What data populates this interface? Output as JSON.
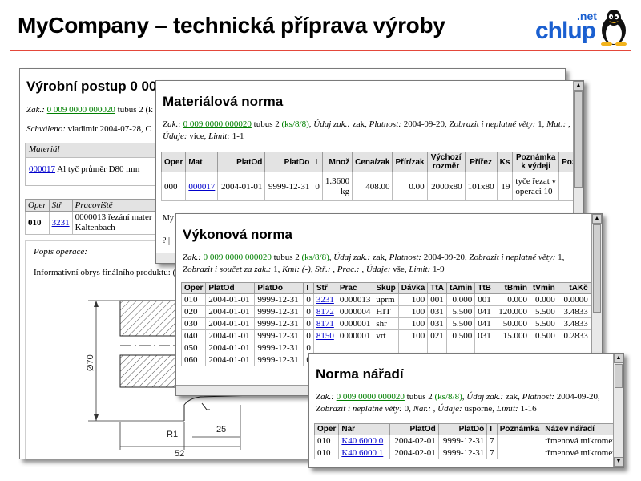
{
  "slide": {
    "title": "MyCompany – technická příprava výroby"
  },
  "logo": {
    "net": ".net",
    "chlup": "chlup"
  },
  "win1": {
    "title": "Výrobní postup 0 00",
    "zak_label": "Zak.:",
    "zak_link": "0 009 0000 000020",
    "zak_rest": "tubus 2 (k",
    "schvaleno_label": "Schváleno:",
    "schvaleno_text": "vladimir 2004-07-28, C",
    "material_header": "Materiál",
    "material_link": "000017",
    "material_text": "Al tyč průměr D80 mm",
    "oper_headers": [
      "Oper",
      "Stř",
      "Pracoviště"
    ],
    "oper_row": {
      "oper": "010",
      "str": "3231",
      "prac": "0000013 řezání mater",
      "prac2": "Kaltenbach"
    },
    "popis_label": "Popis operace:",
    "popis_text": "Informativní obrys finálního produktu: (",
    "dim_70": "Ø70",
    "dim_r1": "R1",
    "dim_25": "25",
    "dim_52": "52"
  },
  "win2": {
    "title": "Materiálová norma",
    "info_zak_label": "Zak.:",
    "info_zak_link": "0 009 0000 000020",
    "info_tubus": "tubus 2",
    "info_ks": "(ks/8/8)",
    "info_udaj_zak": ", Údaj zak.:",
    "info_udaj_zak_val": "zak,",
    "info_platnost": "Platnost:",
    "info_platnost_val": "2004-09-20,",
    "info_zobrazit": "Zobrazit i neplatné věty:",
    "info_zobrazit_val": "1,",
    "info_mat": "Mat.: , Údaje:",
    "info_mat_val": "více,",
    "info_limit": "Limit:",
    "info_limit_val": "1-1",
    "headers": [
      "Oper",
      "Mat",
      "PlatOd",
      "PlatDo",
      "I",
      "Množ",
      "Cena/zak",
      "Přír/zak",
      "Výchozí rozměr",
      "Přířez",
      "Ks",
      "Poznámka k výdeji",
      "Poz"
    ],
    "row": {
      "oper": "000",
      "mat": "000017",
      "platod": "2004-01-01",
      "platdo": "9999-12-31",
      "i": "0",
      "mnoz1": "1.3600",
      "mnoz2": "kg",
      "cena": "408.00",
      "prir": "0.00",
      "vych": "2000x80",
      "prirez": "101x80",
      "ks": "19",
      "pozn1": "tyče řezat v",
      "pozn2": "operaci 10"
    },
    "footer1": "My",
    "footer2": "? |"
  },
  "win3": {
    "title": "Výkonová norma",
    "info_zak_label": "Zak.:",
    "info_zak_link": "0 009 0000 000020",
    "info_tubus": "tubus 2",
    "info_ks": "(ks/8/8)",
    "info_udaj_zak": ", Údaj zak.:",
    "info_udaj_zak_val": "zak,",
    "info_platnost": "Platnost:",
    "info_platnost_val": "2004-09-20,",
    "info_zobrazit": "Zobrazit i neplatné věty:",
    "info_zobrazit_val": "1,",
    "info_line2": "Zobrazit i součet za zak.:",
    "info_line2_val": "1,",
    "info_kmi": "Kmi: (-), Stř.: , Prac.: , Údaje:",
    "info_kmi_val": "vše,",
    "info_limit": "Limit:",
    "info_limit_val": "1-9",
    "headers": [
      "Oper",
      "PlatOd",
      "PlatDo",
      "I",
      "Stř",
      "Prac",
      "Skup",
      "Dávka",
      "TtA",
      "tAmin",
      "TtB",
      "tBmin",
      "tVmin",
      "tAKč"
    ],
    "rows": [
      [
        "010",
        "2004-01-01",
        "9999-12-31",
        "0",
        "3231",
        "0000013",
        "uprm",
        "100",
        "001",
        "0.000",
        "001",
        "0.000",
        "0.000",
        "0.0000"
      ],
      [
        "020",
        "2004-01-01",
        "9999-12-31",
        "0",
        "8172",
        "0000004",
        "HIT",
        "100",
        "031",
        "5.500",
        "041",
        "120.000",
        "5.500",
        "3.4833"
      ],
      [
        "030",
        "2004-01-01",
        "9999-12-31",
        "0",
        "8171",
        "0000001",
        "shr",
        "100",
        "031",
        "5.500",
        "041",
        "50.000",
        "5.500",
        "3.4833"
      ],
      [
        "040",
        "2004-01-01",
        "9999-12-31",
        "0",
        "8150",
        "0000001",
        "vrt",
        "100",
        "021",
        "0.500",
        "031",
        "15.000",
        "0.500",
        "0.2833"
      ],
      [
        "050",
        "2004-01-01",
        "9999-12-31",
        "0",
        "",
        "",
        "",
        "",
        "",
        "",
        "",
        "",
        "",
        ""
      ],
      [
        "060",
        "2004-01-01",
        "9999-12-31",
        "0",
        "",
        "",
        "",
        "",
        "",
        "",
        "",
        "",
        "",
        ""
      ]
    ]
  },
  "win4": {
    "title": "Norma nářadí",
    "info_zak_label": "Zak.:",
    "info_zak_link": "0 009 0000 000020",
    "info_tubus": "tubus 2",
    "info_ks": "(ks/8/8)",
    "info_udaj_zak": ", Údaj zak.:",
    "info_udaj_zak_val": "zak,",
    "info_platnost": "Platnost:",
    "info_line2_date": "2004-09-20,",
    "info_zobrazit": "Zobrazit i neplatné věty:",
    "info_zobrazit_val": "0,",
    "info_nar": "Nar.: , Údaje:",
    "info_nar_val": "úsporné,",
    "info_limit": "Limit:",
    "info_limit_val": "1-16",
    "headers": [
      "Oper",
      "Nar",
      "PlatOd",
      "PlatDo",
      "I",
      "Poznámka",
      "Název nářadí"
    ],
    "rows": [
      [
        "010",
        "K40 6000 0",
        "2004-02-01",
        "9999-12-31",
        "7",
        "",
        "třmenová mikrometri"
      ],
      [
        "010",
        "K40 6000 1",
        "2004-02-01",
        "9999-12-31",
        "7",
        "",
        "třmenové mikrometri"
      ]
    ]
  }
}
